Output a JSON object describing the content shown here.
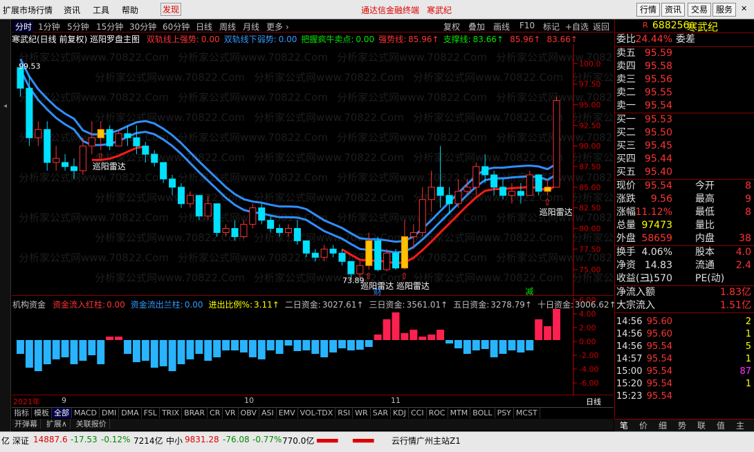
{
  "menu": {
    "items": [
      "扩展市场行情",
      "资讯",
      "工具",
      "帮助"
    ],
    "highlight": "发现",
    "center_title": "通达信金融终端",
    "center_stock": "寒武纪",
    "right_btns": [
      "行情",
      "资讯",
      "交易",
      "服务"
    ]
  },
  "period": {
    "items": [
      "分时",
      "1分钟",
      "5分钟",
      "15分钟",
      "30分钟",
      "60分钟",
      "日线",
      "周线",
      "月线",
      "更多 ›"
    ],
    "active": "日线",
    "right": [
      "复权",
      "叠加",
      "画线",
      "F10",
      "标记",
      "+自选",
      "返回"
    ]
  },
  "info": {
    "title": "寒武纪(日线 前复权) 巡阳罗盘主图",
    "items": [
      {
        "label": "双轨线上强势:",
        "value": "0.00",
        "color": "#ff3333"
      },
      {
        "label": "双轨线下弱势:",
        "value": "0.00",
        "color": "#3399ff"
      },
      {
        "label": "把握疯牛卖点:",
        "value": "0.00",
        "color": "#00e600"
      },
      {
        "label": "强势线:",
        "value": "85.96↑",
        "color": "#ff3333"
      },
      {
        "label": "支撑线:",
        "value": "83.66↑",
        "color": "#00e600"
      },
      {
        "label": "",
        "value": "85.96↑",
        "color": "#ff3333"
      },
      {
        "label": "",
        "value": "83.66↑",
        "color": "#ff3333"
      }
    ]
  },
  "chart": {
    "yticks": [
      "100.0",
      "97.50",
      "95.00",
      "92.50",
      "90.00",
      "87.50",
      "85.00",
      "82.50",
      "80.00",
      "77.50",
      "75.00"
    ],
    "labels": [
      "巡阳雷达",
      "巡阳雷达",
      "巡阳雷达",
      "巡阳雷达"
    ],
    "high_label": "99.53",
    "low_label": "73.89",
    "watermark": "分析家公式网www.70822.Com",
    "mark_cai": "财",
    "mark_jian": "减"
  },
  "flow": {
    "items": [
      {
        "label": "机构资金",
        "value": "",
        "color": "#c0c0c0"
      },
      {
        "label": "资金流入红柱:",
        "value": "0.00",
        "color": "#ff3333"
      },
      {
        "label": "资金流出兰柱:",
        "value": "0.00",
        "color": "#3399ff"
      },
      {
        "label": "进出比例%:",
        "value": "3.11↑",
        "color": "#ffff00"
      },
      {
        "label": "二日资金:",
        "value": "3027.61↑",
        "color": "#c0c0c0"
      },
      {
        "label": "三日资金:",
        "value": "3561.01↑",
        "color": "#c0c0c0"
      },
      {
        "label": "五日资金:",
        "value": "3278.79↑",
        "color": "#c0c0c0"
      },
      {
        "label": "十日资金:",
        "value": "3006.62↑",
        "color": "#c0c0c0"
      }
    ],
    "yticks": [
      "6.00",
      "4.00",
      "2.00",
      "0.00",
      "-2.00",
      "-4.00",
      "-6.00"
    ]
  },
  "dates": {
    "items": [
      "2021年",
      "9",
      "10",
      "11"
    ],
    "right": "日线"
  },
  "indicators": [
    "指标",
    "模板",
    "全部",
    "MACD",
    "DMI",
    "DMA",
    "FSL",
    "TRIX",
    "BRAR",
    "CR",
    "VR",
    "OBV",
    "ASI",
    "EMV",
    "VOL-TDX",
    "RSI",
    "WR",
    "SAR",
    "KDJ",
    "CCI",
    "ROC",
    "MTM",
    "BOLL",
    "PSY",
    "MCST"
  ],
  "bottom_tabs": [
    "开弹幕",
    "扩展∧",
    "关联报价"
  ],
  "status": {
    "sz_label": "亿 深证",
    "sz_val": "14887.6",
    "sz_chg": "-17.53",
    "sz_pct": "-0.12%",
    "sz_amt": "7214亿",
    "zx_label": "中小",
    "zx_val": "9831.28",
    "zx_chg": "-76.08",
    "zx_pct": "-0.77%",
    "zx_amt": "770.0亿",
    "server": "云行情广州主站Z1"
  },
  "quote": {
    "code": "688256",
    "name": "寒武纪",
    "r": "R",
    "weibi_label": "委比",
    "weibi": "24.44%",
    "weicha_label": "委差",
    "sells": [
      {
        "l": "卖五",
        "p": "95.59"
      },
      {
        "l": "卖四",
        "p": "95.58"
      },
      {
        "l": "卖三",
        "p": "95.56"
      },
      {
        "l": "卖二",
        "p": "95.55"
      },
      {
        "l": "卖一",
        "p": "95.54"
      }
    ],
    "buys": [
      {
        "l": "买一",
        "p": "95.53"
      },
      {
        "l": "买二",
        "p": "95.50"
      },
      {
        "l": "买三",
        "p": "95.45"
      },
      {
        "l": "买四",
        "p": "95.44"
      },
      {
        "l": "买五",
        "p": "95.40"
      }
    ],
    "stats": [
      {
        "l": "现价",
        "v": "95.54",
        "c": "#ff3333",
        "l2": "今开",
        "v2": "8"
      },
      {
        "l": "涨跌",
        "v": "9.56",
        "c": "#ff3333",
        "l2": "最高",
        "v2": "9"
      },
      {
        "l": "涨幅",
        "v": "11.12%",
        "c": "#ff3333",
        "l2": "最低",
        "v2": "8"
      },
      {
        "l": "总量",
        "v": "97473",
        "c": "#ffff00",
        "l2": "量比",
        "v2": ""
      },
      {
        "l": "外盘",
        "v": "58659",
        "c": "#ff3333",
        "l2": "内盘",
        "v2": "38"
      }
    ],
    "stats2": [
      {
        "l": "换手",
        "v": "4.06%",
        "c": "#e0e0e0",
        "l2": "股本",
        "v2": "4.0"
      },
      {
        "l": "净资",
        "v": "14.83",
        "c": "#e0e0e0",
        "l2": "流通",
        "v2": "2.4"
      },
      {
        "l": "收益(三)",
        "v": "-1.570",
        "c": "#e0e0e0",
        "l2": "PE(动)",
        "v2": ""
      }
    ],
    "netflow": {
      "l": "净流入额",
      "v": "1.83亿"
    },
    "bigflow": {
      "l": "大宗流入",
      "v": "1.51亿"
    },
    "ticks": [
      {
        "t": "14:56",
        "p": "95.60",
        "v": "2"
      },
      {
        "t": "14:56",
        "p": "95.60",
        "v": "1"
      },
      {
        "t": "14:56",
        "p": "95.54",
        "v": "5"
      },
      {
        "t": "14:57",
        "p": "95.54",
        "v": "1"
      },
      {
        "t": "15:00",
        "p": "95.54",
        "v": "87"
      },
      {
        "t": "15:20",
        "p": "95.54",
        "v": "1"
      },
      {
        "t": "15:23",
        "p": "95.54",
        "v": ""
      }
    ],
    "tabs": [
      "笔",
      "价",
      "细",
      "势",
      "联",
      "值",
      "主"
    ]
  }
}
